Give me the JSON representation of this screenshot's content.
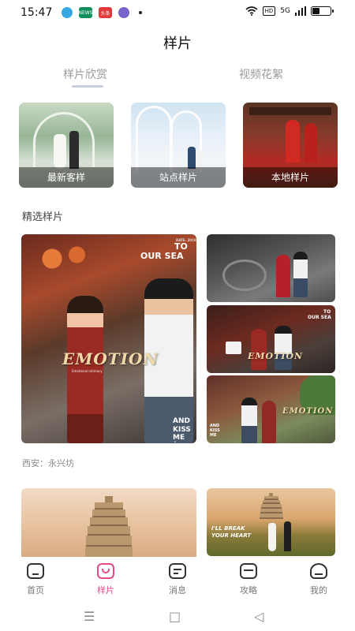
{
  "status_bar": {
    "time": "15:47",
    "app_icons": [
      "browser-app-icon",
      "news-app-icon",
      "toutiao-app-icon",
      "purple-app-icon"
    ],
    "app_icon_texts": [
      "",
      "NEWS",
      "头条",
      ""
    ],
    "hd_label": "HD",
    "signal_label": "5G",
    "battery_level": 0.45
  },
  "page_title": "样片",
  "tabs": [
    {
      "label": "样片欣赏",
      "active": true
    },
    {
      "label": "视频花絮",
      "active": false
    }
  ],
  "categories": [
    {
      "label": "最新客样"
    },
    {
      "label": "站点样片"
    },
    {
      "label": "本地样片"
    }
  ],
  "section_title": "精选样片",
  "featured": {
    "main_overlay": {
      "date_small": "DATE. 2019",
      "to": "TO",
      "our_sea": "OUR SEA",
      "emotion": "EMOTION",
      "caption_small": "Emotional intimacy",
      "and": "AND",
      "kiss": "KISS",
      "me": "ME",
      "tiny": "x"
    },
    "thumb2_overlay": {
      "to": "TO",
      "our_sea": "OUR SEA",
      "emotion": "EMOTION"
    },
    "thumb3_overlay": {
      "and": "AND",
      "kiss": "KISS",
      "me": "ME",
      "emotion": "EMOTION"
    },
    "location": "西安：永兴坊"
  },
  "second_group": {
    "thumb_text_line1": "I'LL BREAK",
    "thumb_text_line2": "YOUR HEART"
  },
  "bottom_nav": [
    {
      "label": "首页",
      "icon": "home-icon",
      "active": false
    },
    {
      "label": "样片",
      "icon": "sample-icon",
      "active": true
    },
    {
      "label": "消息",
      "icon": "message-icon",
      "active": false
    },
    {
      "label": "攻略",
      "icon": "guide-icon",
      "active": false
    },
    {
      "label": "我的",
      "icon": "profile-icon",
      "active": false
    }
  ],
  "system_nav": {
    "menu": "☰",
    "home": "□",
    "back": "◁"
  },
  "colors": {
    "accent": "#e8478a",
    "tab_inactive": "#9a9a9a",
    "indicator": "#c8cfe0"
  }
}
